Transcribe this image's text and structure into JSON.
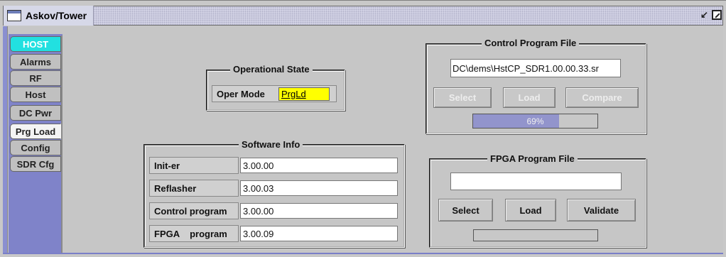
{
  "window": {
    "title": "Askov/Tower"
  },
  "tabs": [
    "HOST",
    "Alarms",
    "RF",
    "Host",
    "DC Pwr",
    "Prg Load",
    "Config",
    "SDR Cfg"
  ],
  "operational_state": {
    "title": "Operational State",
    "oper_mode_label": "Oper Mode",
    "oper_mode_value": "PrgLd"
  },
  "software_info": {
    "title": "Software Info",
    "rows": [
      {
        "label": "Init-er",
        "value": "3.00.00"
      },
      {
        "label": "Reflasher",
        "value": "3.00.03"
      },
      {
        "label": "Control program",
        "value": "3.00.00"
      },
      {
        "label": "FPGA    program",
        "value": "3.00.09"
      }
    ]
  },
  "control_program_file": {
    "title": "Control Program File",
    "path": "DC\\dems\\HstCP_SDR1.00.00.33.sr",
    "select_label": "Select",
    "load_label": "Load",
    "compare_label": "Compare",
    "progress_percent": 69,
    "progress_text": "69%"
  },
  "fpga_program_file": {
    "title": "FPGA Program File",
    "path": "",
    "select_label": "Select",
    "load_label": "Load",
    "validate_label": "Validate",
    "progress_percent": 0
  },
  "colors": {
    "active_tab": "#22e0e0",
    "oper_mode_bg": "#ffff00",
    "progress_fill": "#9294cc",
    "side_strip": "#8a8fd0"
  }
}
